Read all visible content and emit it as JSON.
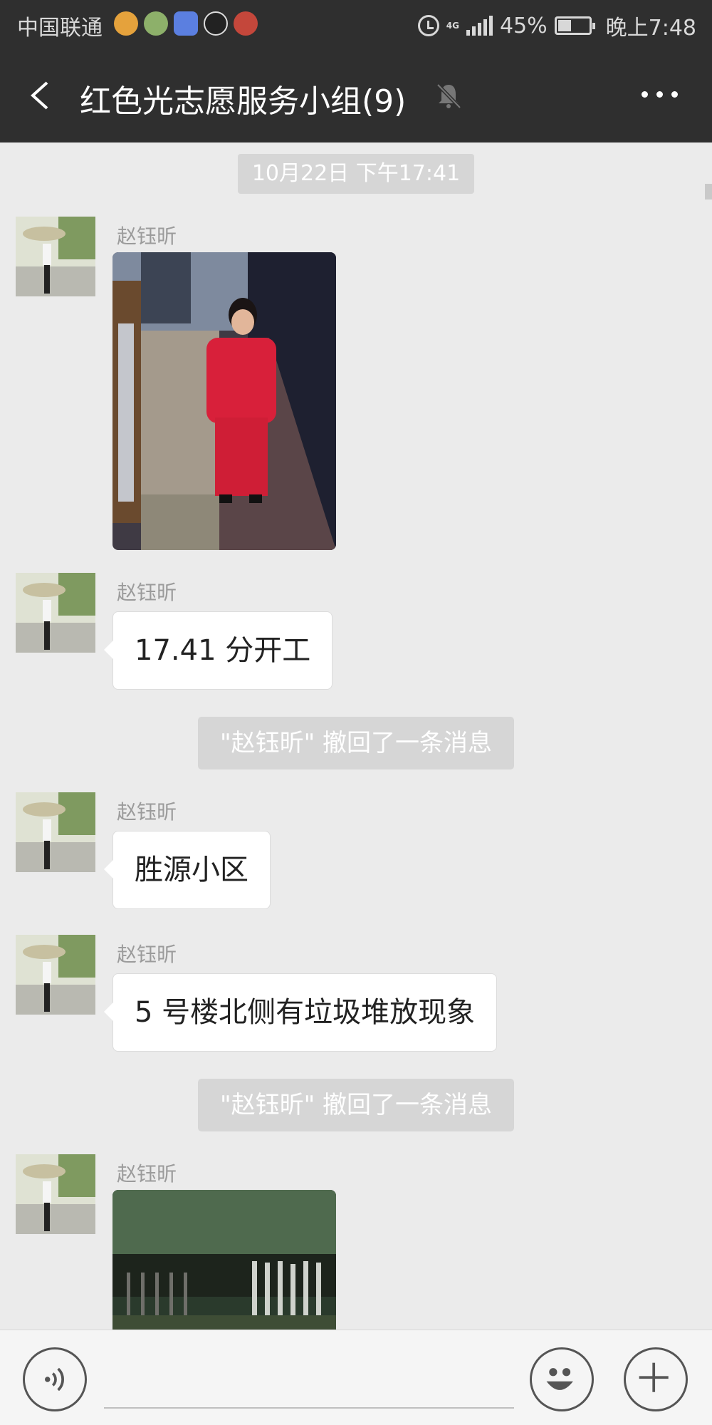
{
  "status_bar": {
    "carrier": "中国联通",
    "app_icon_colors": [
      "#e5a23c",
      "#8db06a",
      "#5b7fe0",
      "#222222",
      "#c4473b"
    ],
    "battery": "45%",
    "time": "晚上7:48",
    "network": "4G"
  },
  "header": {
    "title": "红色光志愿服务小组(9)"
  },
  "chat": {
    "timestamp": "10月22日 下午17:41",
    "messages": [
      {
        "sender": "赵钰昕",
        "type": "image"
      },
      {
        "sender": "赵钰昕",
        "type": "text",
        "text": "17.41 分开工"
      },
      {
        "type": "system",
        "text": "\"赵钰昕\" 撤回了一条消息"
      },
      {
        "sender": "赵钰昕",
        "type": "text",
        "text": "胜源小区"
      },
      {
        "sender": "赵钰昕",
        "type": "text",
        "text": "5 号楼北侧有垃圾堆放现象"
      },
      {
        "type": "system",
        "text": "\"赵钰昕\" 撤回了一条消息"
      },
      {
        "sender": "赵钰昕",
        "type": "image"
      }
    ]
  },
  "colors": {
    "header_bg": "#2f2f2f",
    "chat_bg": "#ebebeb",
    "bubble_bg": "#ffffff",
    "sys_note_bg": "#d6d6d6"
  }
}
